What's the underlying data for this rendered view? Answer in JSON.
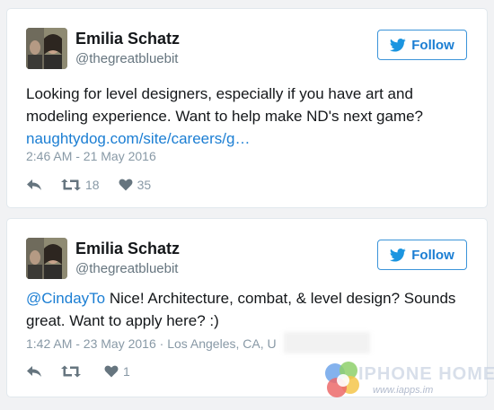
{
  "tweets": [
    {
      "name": "Emilia Schatz",
      "handle": "@thegreatbluebit",
      "follow_label": "Follow",
      "text_before": "Looking for level designers, especially if you have art and modeling experience. Want to help make ND's next game?",
      "link_text": "naughtydog.com/site/careers/g…",
      "timestamp": "2:46 AM - 21 May 2016",
      "retweets": "18",
      "likes": "35"
    },
    {
      "name": "Emilia Schatz",
      "handle": "@thegreatbluebit",
      "follow_label": "Follow",
      "mention": "@CindayTo",
      "text_after": " Nice! Architecture, combat, & level design? Sounds great. Want to apply here? :)",
      "timestamp": "1:42 AM - 23 May 2016 · Los Angeles, CA, U",
      "retweets": "",
      "likes": "1"
    }
  ],
  "watermark": {
    "text": "IPHONE HOME",
    "url": "www.iapps.im"
  },
  "colors": {
    "link": "#1b7ed3",
    "follow_border": "#3b94d9",
    "meta": "#8899a6",
    "card_border": "#e1e8ed"
  },
  "icons": [
    "twitter-bird-icon",
    "reply-icon",
    "retweet-icon",
    "heart-icon"
  ]
}
